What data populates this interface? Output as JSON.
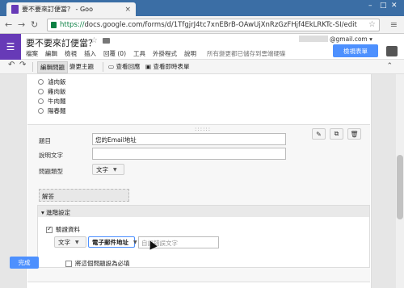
{
  "browser": {
    "tab_title": "要不要來訂便當？ - Goo",
    "url_https": "https://",
    "url_rest": "docs.google.com/forms/d/1TfgjrJ4tc7xnEBrB-OAwUjXnRzGzFHjf4EkLRKTc-SI/edit",
    "close_glyph": "×"
  },
  "doc": {
    "title": "要不要來訂便當？",
    "account": "@gmail.com ▾",
    "view_responses_label": "檢視表單",
    "menus": [
      "檔案",
      "編輯",
      "檢視",
      "插入",
      "回覆 (0)",
      "工具",
      "外掛程式",
      "說明"
    ],
    "save_status": "所有變更都已儲存到雲端硬碟"
  },
  "toolbar": {
    "undo": "↶",
    "redo": "↷",
    "edit_questions": "編輯問題",
    "change_theme": "變更主題",
    "view_responses": "查看回應",
    "view_live_form": "查看即時表單",
    "collapse": "⌃"
  },
  "options": [
    "滷肉飯",
    "雞肉飯",
    "牛肉麵",
    "陽春麵"
  ],
  "editor": {
    "drag_handle": "::::::",
    "title_label": "題目",
    "title_value": "您的Email地址",
    "help_label": "說明文字",
    "help_value": "",
    "type_label": "問題類型",
    "type_value": "文字",
    "preview_text": "解答",
    "advanced_label": "▾ 進階設定",
    "validation_label": "驗證資料",
    "validation_type": "文字",
    "validation_rule": "電子郵件地址",
    "error_placeholder": "自訂錯誤文字",
    "done_label": "完成",
    "required_label": "將這個問題設為必填"
  },
  "icons": {
    "edit": "✎",
    "duplicate": "⧉",
    "delete": "🗑"
  },
  "colors": {
    "brand": "#673ab7",
    "accent": "#4d90fe"
  }
}
